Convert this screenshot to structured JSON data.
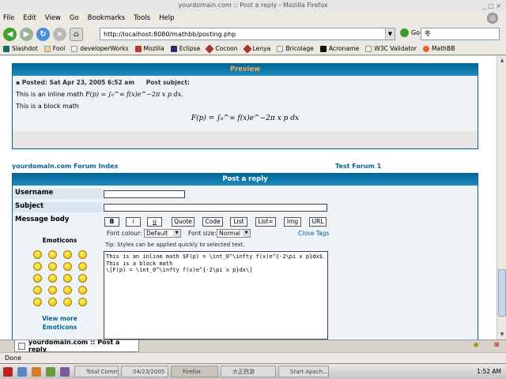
{
  "window": {
    "title": "yourdomain.com :: Post a reply - Mozilla Firefox"
  },
  "menu": [
    "File",
    "Edit",
    "View",
    "Go",
    "Bookmarks",
    "Tools",
    "Help"
  ],
  "nav": {
    "url": "http://localhost:8080/mathbb/posting.php",
    "go_label": "Go",
    "search_value": "冬"
  },
  "bookmarks": [
    "Slashdot",
    "Fool",
    "developerWorks",
    "Mozilla",
    "Eclipse",
    "Cocoon",
    "Lenya",
    "Bricolage",
    "Acroname",
    "W3C Validator",
    "MathBB"
  ],
  "preview": {
    "header": "Preview",
    "posted": "Posted: Sat Apr 23, 2005 6:52 am",
    "subject_label": "Post subject:",
    "line1": "This is an inline math",
    "inline_math": "F(p) = ∫₀^∞ f(x)e^−2π x p dx.",
    "line2": "This is a block math",
    "block_math": "F(p) = ∫₀^∞ f(x)e^−2π x p dx"
  },
  "breadcrumb": {
    "left": "yourdomain.com Forum Index",
    "right": "Test Forum 1"
  },
  "form": {
    "header": "Post a reply",
    "username_label": "Username",
    "subject_label": "Subject",
    "message_label": "Message body",
    "format_buttons": [
      "B",
      "i",
      "u",
      "Quote",
      "Code",
      "List",
      "List=",
      "Img",
      "URL"
    ],
    "font_colour_label": "Font colour:",
    "font_colour_value": "Default",
    "font_size_label": "Font size:",
    "font_size_value": "Normal",
    "close_tags": "Close Tags",
    "tip": "Tip: Styles can be applied quickly to selected text.",
    "message_text": "This is an inline math $F(p) = \\int_0^\\infty f(x)e^{-2\\pi x p}dx$.\nThis is a block math\n\\[F(p) = \\int_0^\\infty f(x)e^{-2\\pi x p}dx\\]"
  },
  "emoticons": {
    "header": "Emoticons",
    "view_more_1": "View more",
    "view_more_2": "Emoticons"
  },
  "tab": {
    "label": "yourdomain.com :: Post a reply"
  },
  "status": "Done",
  "taskbar": {
    "tasks": [
      "Total Comm...",
      "04/23/2005 ...",
      "Firefox",
      "大正西游",
      "Start Apach..."
    ],
    "clock": "1:52 AM"
  }
}
